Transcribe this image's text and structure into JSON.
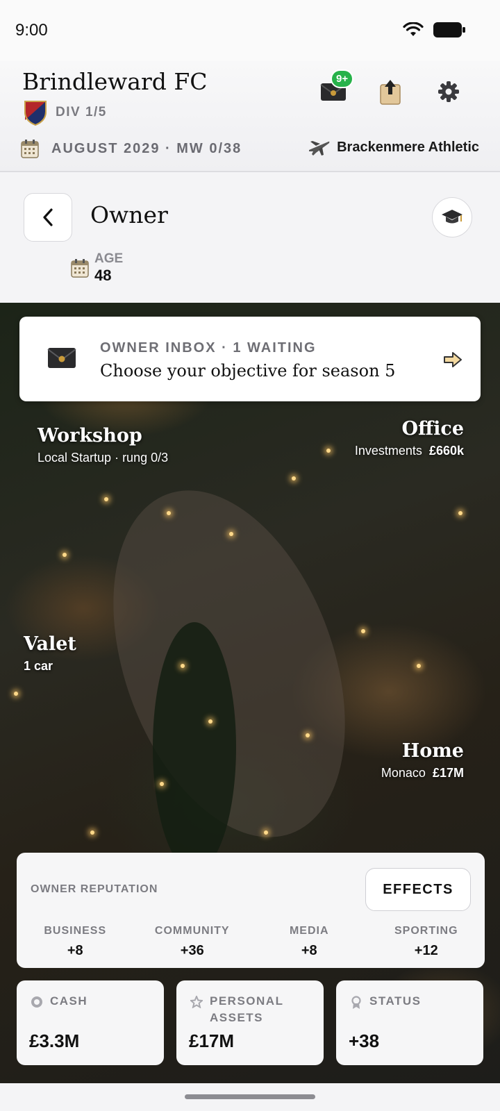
{
  "status_bar": {
    "time": "9:00"
  },
  "header": {
    "club_name": "Brindleward FC",
    "division": "DIV 1/5",
    "inbox_badge": "9+",
    "date_line": "AUGUST 2029 · MW 0/38",
    "next_opponent": "Brackenmere Athletic"
  },
  "page": {
    "title": "Owner",
    "age_label": "AGE",
    "age_value": "48"
  },
  "inbox": {
    "label": "OWNER INBOX · 1 WAITING",
    "message": "Choose your objective for season 5"
  },
  "locations": {
    "workshop": {
      "title": "Workshop",
      "sub": "Local Startup · rung 0/3"
    },
    "office": {
      "title": "Office",
      "sub_label": "Investments",
      "sub_value": "£660k"
    },
    "valet": {
      "title": "Valet",
      "sub": "1 car"
    },
    "home": {
      "title": "Home",
      "sub_label": "Monaco",
      "sub_value": "£17M"
    }
  },
  "reputation": {
    "title": "OWNER REPUTATION",
    "effects_label": "EFFECTS",
    "stats": [
      {
        "label": "BUSINESS",
        "value": "+8"
      },
      {
        "label": "COMMUNITY",
        "value": "+36"
      },
      {
        "label": "MEDIA",
        "value": "+8"
      },
      {
        "label": "SPORTING",
        "value": "+12"
      }
    ]
  },
  "cards": [
    {
      "label": "CASH",
      "value": "£3.3M",
      "icon": "coin-icon"
    },
    {
      "label": "PERSONAL ASSETS",
      "value": "£17M",
      "icon": "star-icon"
    },
    {
      "label": "STATUS",
      "value": "+38",
      "icon": "award-icon"
    }
  ],
  "colors": {
    "badge_green": "#27b24a",
    "crest_red": "#b3262a",
    "crest_navy": "#1f2f6b"
  }
}
